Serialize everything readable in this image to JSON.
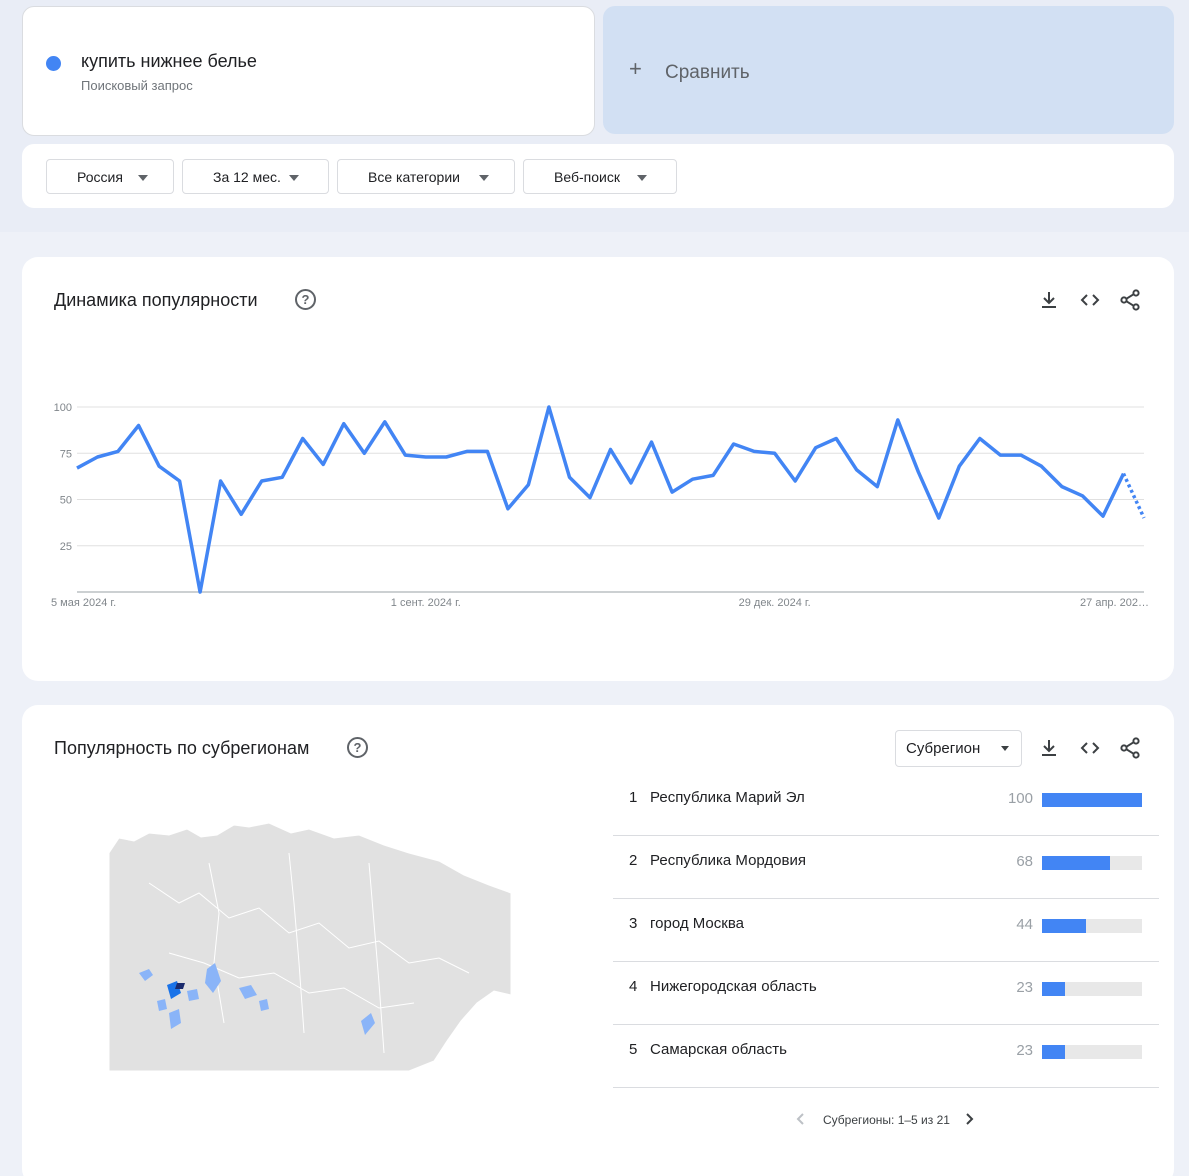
{
  "search_term": {
    "title": "купить нижнее белье",
    "subtitle": "Поисковый запрос",
    "color": "#4285f4"
  },
  "compare": {
    "plus": "+",
    "label": "Сравнить"
  },
  "filters": [
    {
      "label": "Россия"
    },
    {
      "label": "За 12 мес."
    },
    {
      "label": "Все категории"
    },
    {
      "label": "Веб-поиск"
    }
  ],
  "interest_over_time": {
    "title": "Динамика популярности",
    "help": "?",
    "actions": [
      "download-icon",
      "embed-icon",
      "share-icon"
    ]
  },
  "chart_data": {
    "type": "line",
    "x": [
      "5 мая 2024 г.",
      "12 мая 2024 г.",
      "19 мая 2024 г.",
      "26 мая 2024 г.",
      "2 июн. 2024 г.",
      "9 июн. 2024 г.",
      "16 июн. 2024 г.",
      "23 июн. 2024 г.",
      "30 июн. 2024 г.",
      "7 июл. 2024 г.",
      "14 июл. 2024 г.",
      "21 июл. 2024 г.",
      "28 июл. 2024 г.",
      "4 авг. 2024 г.",
      "11 авг. 2024 г.",
      "18 авг. 2024 г.",
      "25 авг. 2024 г.",
      "1 сент. 2024 г.",
      "8 сент. 2024 г.",
      "15 сент. 2024 г.",
      "22 сент. 2024 г.",
      "29 сент. 2024 г.",
      "6 окт. 2024 г.",
      "13 окт. 2024 г.",
      "20 окт. 2024 г.",
      "27 окт. 2024 г.",
      "3 нояб. 2024 г.",
      "10 нояб. 2024 г.",
      "17 нояб. 2024 г.",
      "24 нояб. 2024 г.",
      "1 дек. 2024 г.",
      "8 дек. 2024 г.",
      "15 дек. 2024 г.",
      "22 дек. 2024 г.",
      "29 дек. 2024 г.",
      "5 янв. 2025 г.",
      "12 янв. 2025 г.",
      "19 янв. 2025 г.",
      "26 янв. 2025 г.",
      "2 февр. 2025 г.",
      "9 февр. 2025 г.",
      "16 февр. 2025 г.",
      "23 февр. 2025 г.",
      "2 мар. 2025 г.",
      "9 мар. 2025 г.",
      "16 мар. 2025 г.",
      "23 мар. 2025 г.",
      "30 мар. 2025 г.",
      "6 апр. 2025 г.",
      "13 апр. 2025 г.",
      "20 апр. 2025 г.",
      "27 апр. 2025 г."
    ],
    "series": [
      {
        "values": [
          67,
          73,
          76,
          90,
          68,
          60,
          0,
          60,
          42,
          60,
          62,
          83,
          69,
          91,
          75,
          92,
          74,
          73,
          73,
          76,
          76,
          45,
          58,
          100,
          62,
          51,
          77,
          59,
          81,
          54,
          61,
          63,
          80,
          76,
          75,
          60,
          78,
          83,
          66,
          57,
          93,
          65,
          40,
          68,
          83,
          74,
          74,
          68,
          57,
          52,
          41,
          64,
          40
        ],
        "partial_last": true,
        "color": "#4285f4"
      }
    ],
    "x_tick_labels": [
      "5 мая 2024 г.",
      "1 сент. 2024 г.",
      "29 дек. 2024 г.",
      "27 апр. 202…"
    ],
    "x_tick_index": [
      0,
      17,
      34,
      51
    ],
    "y_ticks": [
      25,
      50,
      75,
      100
    ],
    "ylim": [
      0,
      100
    ],
    "grid": true
  },
  "subregions": {
    "title": "Популярность по субрегионам",
    "help": "?",
    "dropdown_label": "Субрегион",
    "rows": [
      {
        "rank": "1",
        "name": "Республика Марий Эл",
        "value": 100
      },
      {
        "rank": "2",
        "name": "Республика Мордовия",
        "value": 68
      },
      {
        "rank": "3",
        "name": "город Москва",
        "value": 44
      },
      {
        "rank": "4",
        "name": "Нижегородская область",
        "value": 23
      },
      {
        "rank": "5",
        "name": "Самарская область",
        "value": 23
      }
    ],
    "pager_label": "Субрегионы: 1–5 из 21"
  }
}
